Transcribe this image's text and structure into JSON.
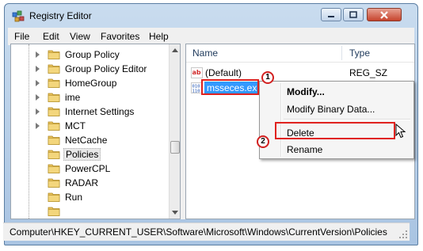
{
  "window": {
    "title": "Registry Editor"
  },
  "menubar": {
    "items": [
      "File",
      "Edit",
      "View",
      "Favorites",
      "Help"
    ]
  },
  "tree": {
    "items": [
      {
        "label": "Group Policy",
        "selected": false
      },
      {
        "label": "Group Policy Editor",
        "selected": false
      },
      {
        "label": "HomeGroup",
        "selected": false
      },
      {
        "label": "ime",
        "selected": false
      },
      {
        "label": "Internet Settings",
        "selected": false
      },
      {
        "label": "MCT",
        "selected": false
      },
      {
        "label": "NetCache",
        "selected": false
      },
      {
        "label": "Policies",
        "selected": true
      },
      {
        "label": "PowerCPL",
        "selected": false
      },
      {
        "label": "RADAR",
        "selected": false
      },
      {
        "label": "Run",
        "selected": false
      }
    ]
  },
  "values": {
    "columns": {
      "name": "Name",
      "type": "Type"
    },
    "rows": [
      {
        "name": "(Default)",
        "type": "REG_SZ",
        "icon": "string-value-icon"
      },
      {
        "name": "msseces.exe",
        "type": "",
        "icon": "binary-value-icon",
        "selected": true
      }
    ]
  },
  "context_menu": {
    "items": [
      {
        "label": "Modify...",
        "bold": true
      },
      {
        "label": "Modify Binary Data...",
        "bold": false
      },
      {
        "label": "Delete",
        "bold": false
      },
      {
        "label": "Rename",
        "bold": false
      }
    ]
  },
  "annotations": {
    "step1": "1",
    "step2": "2"
  },
  "statusbar": {
    "path": "Computer\\HKEY_CURRENT_USER\\Software\\Microsoft\\Windows\\CurrentVersion\\Policies"
  },
  "colors": {
    "highlight": "#3399ff",
    "annotation_red": "#e0221f",
    "folder": "#e8c15a"
  }
}
